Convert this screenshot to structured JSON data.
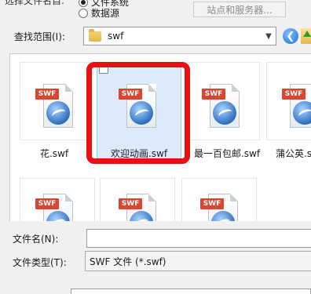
{
  "source_row": {
    "cut_label": "选择文件名自:",
    "radio_filesystem": "文件系统",
    "radio_datasource": "数据源",
    "site_server_button": "站点和服务器..."
  },
  "lookin": {
    "label": "查找范围(I):",
    "folder": "swf",
    "folder_icon": "folder-icon",
    "back_icon": "back-arrow-icon",
    "up_icon": "up-folder-icon"
  },
  "files": [
    {
      "name": "花.swf",
      "selected": false
    },
    {
      "name": "欢迎动画.swf",
      "selected": true
    },
    {
      "name": "最一百包邮.swf",
      "selected": false
    },
    {
      "name": "蒲公英.swf",
      "selected": false
    },
    {
      "name": "",
      "selected": false
    },
    {
      "name": "",
      "selected": false
    },
    {
      "name": "",
      "selected": false
    }
  ],
  "swf_badge": "SWF",
  "filename": {
    "label": "文件名(N):",
    "value": ""
  },
  "filetype": {
    "label": "文件类型(T):",
    "value": "SWF 文件 (*.swf)"
  },
  "colors": {
    "highlight_frame": "#e81010",
    "selected_tile": "#dcebfc",
    "swf_badge": "#d9452f"
  }
}
